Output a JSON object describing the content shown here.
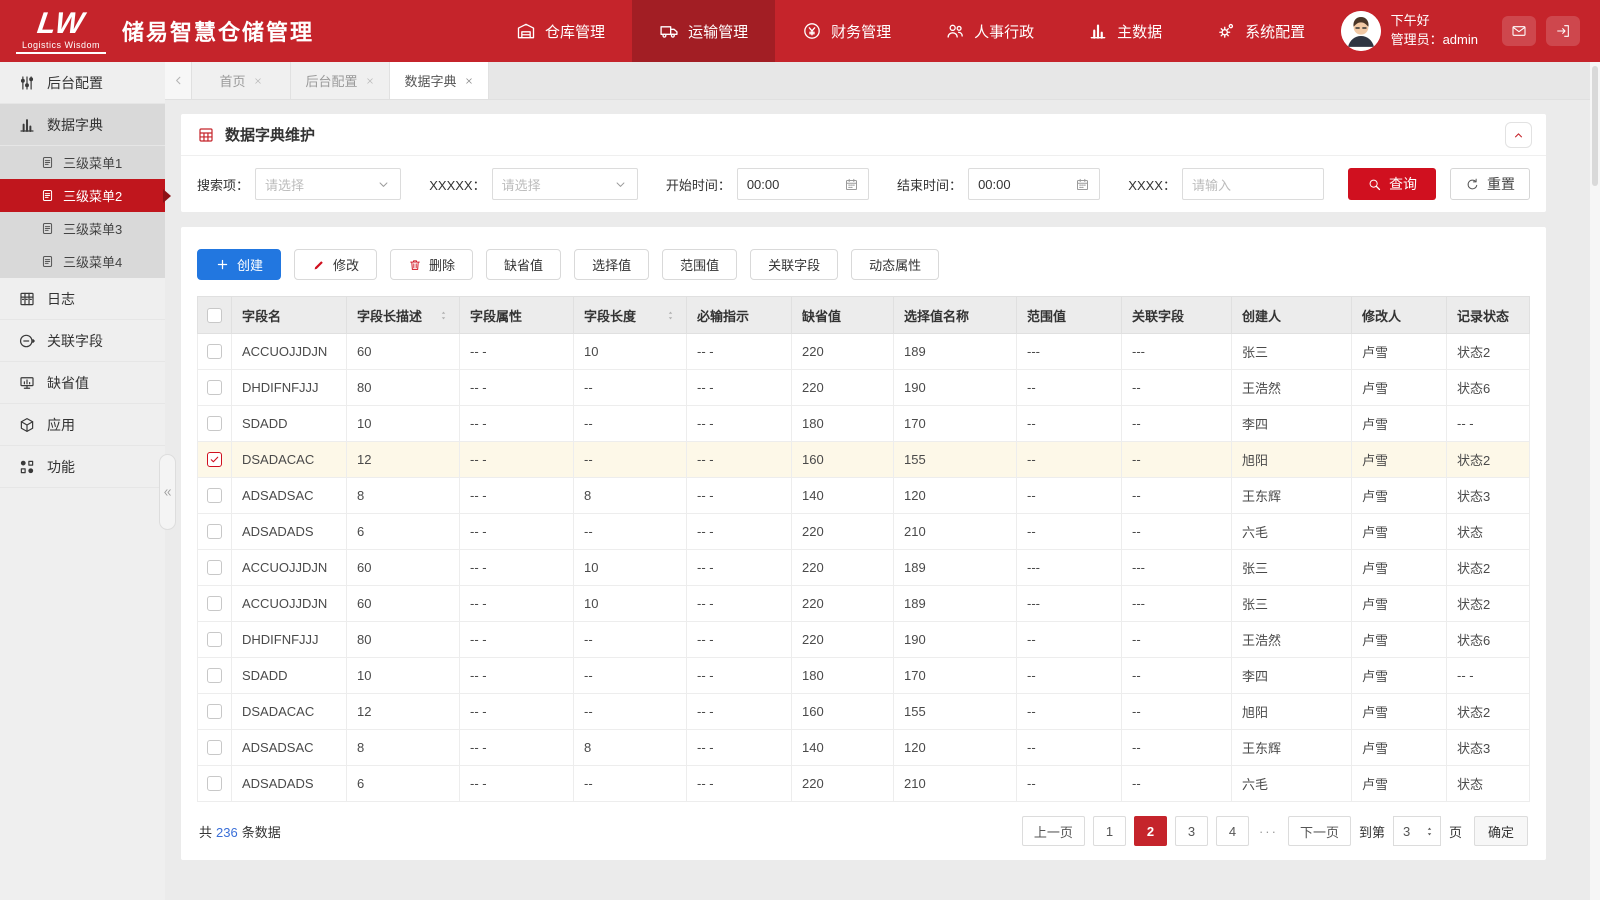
{
  "brand": {
    "mark": "LW",
    "subtitle": "Logistics Wisdom",
    "title": "储易智慧仓储管理"
  },
  "top_nav": {
    "items": [
      {
        "label": "仓库管理",
        "icon": "warehouse",
        "active": false
      },
      {
        "label": "运输管理",
        "icon": "truck",
        "active": true
      },
      {
        "label": "财务管理",
        "icon": "finance",
        "active": false
      },
      {
        "label": "人事行政",
        "icon": "hr",
        "active": false
      },
      {
        "label": "主数据",
        "icon": "masterdata",
        "active": false
      },
      {
        "label": "系统配置",
        "icon": "settings",
        "active": false
      }
    ]
  },
  "user": {
    "greeting": "下午好",
    "role": "管理员：admin"
  },
  "header_actions": [
    {
      "icon": "mail"
    },
    {
      "icon": "logout"
    }
  ],
  "sidebar": {
    "items": [
      {
        "label": "后台配置",
        "icon": "sliders",
        "selected": false
      },
      {
        "label": "数据字典",
        "icon": "dict",
        "selected": true,
        "children": [
          {
            "label": "三级菜单1",
            "icon": "doc",
            "active": false
          },
          {
            "label": "三级菜单2",
            "icon": "doc",
            "active": true
          },
          {
            "label": "三级菜单3",
            "icon": "doc",
            "active": false
          },
          {
            "label": "三级菜单4",
            "icon": "doc",
            "active": false
          }
        ]
      },
      {
        "label": "日志",
        "icon": "log",
        "selected": false
      },
      {
        "label": "关联字段",
        "icon": "link",
        "selected": false
      },
      {
        "label": "缺省值",
        "icon": "monitor",
        "selected": false
      },
      {
        "label": "应用",
        "icon": "app",
        "selected": false
      },
      {
        "label": "功能",
        "icon": "func",
        "selected": false
      }
    ]
  },
  "tabs": [
    {
      "label": "首页",
      "active": false
    },
    {
      "label": "后台配置",
      "active": false
    },
    {
      "label": "数据字典",
      "active": true
    }
  ],
  "panel": {
    "title": "数据字典维护"
  },
  "filters": {
    "items": [
      {
        "label": "搜索项：",
        "type": "select",
        "placeholder": "请选择"
      },
      {
        "label": "XXXXX：",
        "type": "select",
        "placeholder": "请选择"
      },
      {
        "label": "开始时间：",
        "type": "time",
        "value": "00:00"
      },
      {
        "label": "结束时间：",
        "type": "time",
        "value": "00:00"
      },
      {
        "label": "XXXX：",
        "type": "text",
        "placeholder": "请输入"
      }
    ],
    "query_label": "查询",
    "reset_label": "重置"
  },
  "toolbar": {
    "buttons": [
      {
        "label": "创建",
        "icon": "plus",
        "variant": "primary"
      },
      {
        "label": "修改",
        "icon": "pencil",
        "variant": "default"
      },
      {
        "label": "删除",
        "icon": "trash",
        "variant": "default"
      },
      {
        "label": "缺省值",
        "variant": "default"
      },
      {
        "label": "选择值",
        "variant": "default"
      },
      {
        "label": "范围值",
        "variant": "default"
      },
      {
        "label": "关联字段",
        "variant": "default"
      },
      {
        "label": "动态属性",
        "variant": "default"
      }
    ]
  },
  "table": {
    "columns": [
      {
        "label": "字段名",
        "sortable": false
      },
      {
        "label": "字段长描述",
        "sortable": true
      },
      {
        "label": "字段属性",
        "sortable": false
      },
      {
        "label": "字段长度",
        "sortable": true
      },
      {
        "label": "必输指示",
        "sortable": false
      },
      {
        "label": "缺省值",
        "sortable": false
      },
      {
        "label": "选择值名称",
        "sortable": false
      },
      {
        "label": "范围值",
        "sortable": false
      },
      {
        "label": "关联字段",
        "sortable": false
      },
      {
        "label": "创建人",
        "sortable": false
      },
      {
        "label": "修改人",
        "sortable": false
      },
      {
        "label": "记录状态",
        "sortable": false
      }
    ],
    "rows": [
      {
        "checked": false,
        "cells": [
          "ACCUOJJDJN",
          "60",
          "-- -",
          "10",
          "-- -",
          "220",
          "189",
          "---",
          "---",
          "张三",
          "卢雪",
          "状态2"
        ]
      },
      {
        "checked": false,
        "cells": [
          "DHDIFNFJJJ",
          "80",
          "-- -",
          "--",
          "-- -",
          "220",
          "190",
          "--",
          "--",
          "王浩然",
          "卢雪",
          "状态6"
        ]
      },
      {
        "checked": false,
        "cells": [
          "SDADD",
          "10",
          "-- -",
          "--",
          "-- -",
          "180",
          "170",
          "--",
          "--",
          "李四",
          "卢雪",
          "-- -"
        ]
      },
      {
        "checked": true,
        "cells": [
          "DSADACAC",
          "12",
          "-- -",
          "--",
          "-- -",
          "160",
          "155",
          "--",
          "--",
          "旭阳",
          "卢雪",
          "状态2"
        ]
      },
      {
        "checked": false,
        "cells": [
          "ADSADSAC",
          "8",
          "-- -",
          "8",
          "-- -",
          "140",
          "120",
          "--",
          "--",
          "王东辉",
          "卢雪",
          "状态3"
        ]
      },
      {
        "checked": false,
        "cells": [
          "ADSADADS",
          "6",
          "-- -",
          "--",
          "-- -",
          "220",
          "210",
          "--",
          "--",
          "六毛",
          "卢雪",
          "状态"
        ]
      },
      {
        "checked": false,
        "cells": [
          "ACCUOJJDJN",
          "60",
          "-- -",
          "10",
          "-- -",
          "220",
          "189",
          "---",
          "---",
          "张三",
          "卢雪",
          "状态2"
        ]
      },
      {
        "checked": false,
        "cells": [
          "ACCUOJJDJN",
          "60",
          "-- -",
          "10",
          "-- -",
          "220",
          "189",
          "---",
          "---",
          "张三",
          "卢雪",
          "状态2"
        ]
      },
      {
        "checked": false,
        "cells": [
          "DHDIFNFJJJ",
          "80",
          "-- -",
          "--",
          "-- -",
          "220",
          "190",
          "--",
          "--",
          "王浩然",
          "卢雪",
          "状态6"
        ]
      },
      {
        "checked": false,
        "cells": [
          "SDADD",
          "10",
          "-- -",
          "--",
          "-- -",
          "180",
          "170",
          "--",
          "--",
          "李四",
          "卢雪",
          "-- -"
        ]
      },
      {
        "checked": false,
        "cells": [
          "DSADACAC",
          "12",
          "-- -",
          "--",
          "-- -",
          "160",
          "155",
          "--",
          "--",
          "旭阳",
          "卢雪",
          "状态2"
        ]
      },
      {
        "checked": false,
        "cells": [
          "ADSADSAC",
          "8",
          "-- -",
          "8",
          "-- -",
          "140",
          "120",
          "--",
          "--",
          "王东辉",
          "卢雪",
          "状态3"
        ]
      },
      {
        "checked": false,
        "cells": [
          "ADSADADS",
          "6",
          "-- -",
          "--",
          "-- -",
          "220",
          "210",
          "--",
          "--",
          "六毛",
          "卢雪",
          "状态"
        ]
      }
    ]
  },
  "footer": {
    "total_prefix": "共",
    "total_count": "236",
    "total_suffix": "条数据",
    "pagination": {
      "prev": "上一页",
      "pages": [
        "1",
        "2",
        "3",
        "4"
      ],
      "active_page": "2",
      "ellipsis": "···",
      "next": "下一页",
      "goto_prefix": "到第",
      "goto_value": "3",
      "goto_suffix": "页",
      "confirm": "确定"
    }
  },
  "colors": {
    "header_red": "#c5242b",
    "active_nav_red": "#a21e24",
    "sidebar_active_red": "#c0161d",
    "query_red": "#d0101f",
    "primary_blue": "#2277e0",
    "row_highlight": "#fdf8e8",
    "link_blue": "#3a6fd8"
  }
}
